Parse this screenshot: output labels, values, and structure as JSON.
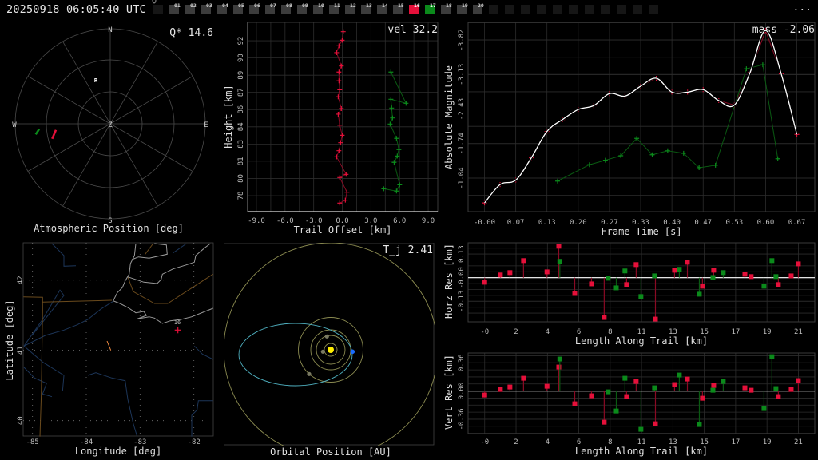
{
  "header": {
    "timestamp": "20250918 06:05:40 UTC",
    "menu_label": "...",
    "stations": [
      {
        "label": "01",
        "state": "idle"
      },
      {
        "label": "02",
        "state": "idle"
      },
      {
        "label": "03",
        "state": "idle"
      },
      {
        "label": "04",
        "state": "idle"
      },
      {
        "label": "05",
        "state": "idle"
      },
      {
        "label": "06",
        "state": "idle"
      },
      {
        "label": "07",
        "state": "idle"
      },
      {
        "label": "08",
        "state": "idle"
      },
      {
        "label": "09",
        "state": "idle"
      },
      {
        "label": "10",
        "state": "idle"
      },
      {
        "label": "11",
        "state": "idle"
      },
      {
        "label": "12",
        "state": "idle"
      },
      {
        "label": "13",
        "state": "idle"
      },
      {
        "label": "14",
        "state": "idle"
      },
      {
        "label": "15",
        "state": "idle"
      },
      {
        "label": "16",
        "state": "red"
      },
      {
        "label": "17",
        "state": "green"
      },
      {
        "label": "18",
        "state": "idle"
      },
      {
        "label": "19",
        "state": "idle"
      },
      {
        "label": "20",
        "state": "idle"
      }
    ]
  },
  "colors": {
    "station_a": "#e5103a",
    "station_b": "#0b8a1b",
    "fit": "#ffffff",
    "orbit": "#4fb0c0",
    "planet_orbit": "#8a8a50",
    "sun": "#ffee00",
    "earth": "#1a6cff"
  },
  "polar": {
    "title": "Atmospheric Position [deg]",
    "stat": "Q* 14.6",
    "labels": {
      "n": "N",
      "s": "S",
      "e": "E",
      "w": "W",
      "z": "Z",
      "radiant": "R"
    }
  },
  "map": {
    "xlabel": "Longitude [deg]",
    "ylabel": "Latitude [deg]",
    "lon_ticks": [
      "-85",
      "-84",
      "-83",
      "-82"
    ],
    "lat_ticks": [
      "40",
      "41",
      "42"
    ],
    "station_label": "16"
  },
  "orbit": {
    "title": "Orbital Position [AU]",
    "stat": "T_j 2.41"
  },
  "chart_data": [
    {
      "type": "line",
      "title": "",
      "stat": "vel 32.2",
      "xlabel": "Trail Offset [km]",
      "ylabel": "Height [km]",
      "xlim": [
        -9.92,
        10.0
      ],
      "ylim": [
        76.76,
        93.81
      ],
      "x_ticks": {
        "values": [
          -9,
          -6,
          -3,
          0,
          3,
          6,
          9
        ],
        "labels": [
          "-9.0",
          "-6.0",
          "-3.0",
          "0.0",
          "3.0",
          "6.0",
          "9.0"
        ]
      },
      "y_ticks": {
        "values": [
          78.2,
          79.75,
          81.3,
          82.85,
          84.4,
          85.95,
          87.5,
          89.05,
          90.6,
          92.15
        ],
        "labels": [
          "78",
          "80",
          "81",
          "83",
          "84",
          "86",
          "87",
          "89",
          "90",
          "92"
        ]
      },
      "series": [
        {
          "name": "station-16",
          "color": "#e5103a",
          "x": [
            0.1,
            -0.01,
            -0.35,
            -0.6,
            -0.1,
            -0.35,
            -0.35,
            -0.27,
            -0.43,
            -0.1,
            -0.43,
            -0.27,
            -0.01,
            -0.18,
            -0.35,
            -0.6,
            0.4,
            -0.27,
            0.49,
            0.32,
            -0.27
          ],
          "y": [
            92.97,
            92.2,
            91.7,
            91.08,
            89.88,
            89.33,
            88.54,
            87.74,
            87.1,
            86.04,
            85.54,
            84.55,
            83.64,
            82.97,
            82.25,
            81.7,
            80.12,
            79.83,
            78.51,
            77.79,
            77.53
          ]
        },
        {
          "name": "station-17",
          "color": "#0b8a1b",
          "x": [
            5.09,
            6.68,
            5.09,
            5.17,
            5.26,
            5.01,
            5.68,
            5.93,
            5.76,
            5.43,
            6.01,
            5.68,
            4.34
          ],
          "y": [
            89.33,
            86.52,
            86.88,
            86.09,
            85.2,
            84.65,
            83.36,
            82.35,
            81.77,
            81.2,
            79.18,
            78.61,
            78.82
          ]
        }
      ]
    },
    {
      "type": "line",
      "title": "",
      "stat": "mass -2.06",
      "xlabel": "Frame Time [s]",
      "ylabel": "Absolute Magnitude",
      "xlim": [
        -0.035,
        0.705
      ],
      "ylim": [
        -0.365,
        -4.175
      ],
      "x_ticks": {
        "values": [
          0,
          0.0667,
          0.1333,
          0.2,
          0.2667,
          0.3333,
          0.4,
          0.4667,
          0.5333,
          0.6,
          0.6667
        ],
        "labels": [
          "-0.00",
          "0.07",
          "0.13",
          "0.20",
          "0.27",
          "0.33",
          "0.40",
          "0.47",
          "0.53",
          "0.60",
          "0.67"
        ]
      },
      "y_ticks": {
        "values": [
          -3.82,
          -3.125,
          -2.43,
          -1.735,
          -1.04
        ],
        "labels": [
          "-3.82",
          "-3.13",
          "-2.43",
          "-1.74",
          "-1.04"
        ]
      },
      "series": [
        {
          "name": "station-16",
          "color": "#e5103a",
          "x": [
            0,
            0.0333,
            0.0667,
            0.1,
            0.1333,
            0.1667,
            0.2,
            0.2333,
            0.2667,
            0.3,
            0.3333,
            0.3667,
            0.4,
            0.4333,
            0.4667,
            0.5,
            0.5333,
            0.5667,
            0.6,
            0.6333,
            0.6667
          ],
          "y": [
            -0.54,
            -0.91,
            -1.0,
            -1.45,
            -1.98,
            -2.22,
            -2.42,
            -2.5,
            -2.74,
            -2.69,
            -2.89,
            -3.05,
            -2.77,
            -2.77,
            -2.82,
            -2.6,
            -2.51,
            -3.16,
            -4.01,
            -3.14,
            -1.92
          ]
        },
        {
          "name": "station-17",
          "color": "#0b8a1b",
          "x": [
            0.156,
            0.224,
            0.258,
            0.291,
            0.325,
            0.358,
            0.391,
            0.425,
            0.458,
            0.493,
            0.559,
            0.594,
            0.626
          ],
          "y": [
            -0.98,
            -1.31,
            -1.4,
            -1.49,
            -1.84,
            -1.51,
            -1.59,
            -1.54,
            -1.25,
            -1.3,
            -3.24,
            -3.32,
            -1.43
          ]
        },
        {
          "name": "fit",
          "color": "#ffffff",
          "smooth_of": "station-16"
        }
      ]
    },
    {
      "type": "scatter",
      "title": "",
      "xlabel": "Length Along Trail [km]",
      "ylabel": "Horz Res [km]",
      "xlim": [
        -1.11,
        22.1
      ],
      "ylim": [
        -0.243,
        0.192
      ],
      "x_ticks": {
        "values": [
          0,
          2.1,
          4.2,
          6.3,
          8.4,
          10.5,
          12.6,
          14.7,
          16.8,
          18.9,
          21.0
        ],
        "labels": [
          "-0",
          "2",
          "4",
          "6",
          "8",
          "11",
          "13",
          "15",
          "17",
          "19",
          "21"
        ]
      },
      "y_ticks": {
        "values": [
          0.13,
          0.0,
          -0.13
        ],
        "labels": [
          "0.13",
          "-0.00",
          "-0.13"
        ]
      },
      "series": [
        {
          "name": "station-16",
          "color": "#e5103a",
          "x": [
            0,
            1.05,
            1.69,
            2.6,
            4.17,
            4.96,
            6.03,
            7.15,
            8.0,
            9.5,
            10.14,
            11.43,
            12.71,
            13.57,
            14.58,
            15.33,
            17.42,
            17.84,
            19.66,
            20.52,
            21.0
          ],
          "y": [
            -0.025,
            0.015,
            0.028,
            0.094,
            0.032,
            0.173,
            -0.087,
            -0.034,
            -0.219,
            -0.038,
            0.072,
            -0.228,
            0.041,
            0.085,
            -0.047,
            0.041,
            0.019,
            0.006,
            -0.038,
            0.01,
            0.076
          ]
        },
        {
          "name": "station-17",
          "color": "#0b8a1b",
          "x": [
            5.03,
            8.27,
            8.81,
            9.39,
            10.46,
            11.37,
            13.03,
            14.37,
            15.28,
            15.97,
            18.7,
            19.23,
            19.5
          ],
          "y": [
            0.09,
            -0.003,
            -0.056,
            0.037,
            -0.104,
            0.01,
            0.046,
            -0.091,
            0.001,
            0.028,
            -0.047,
            0.094,
            0.006
          ]
        }
      ]
    },
    {
      "type": "scatter",
      "title": "",
      "xlabel": "Length Along Trail [km]",
      "ylabel": "Vert Res [km]",
      "xlim": [
        -1.11,
        22.1
      ],
      "ylim": [
        -0.544,
        0.485
      ],
      "x_ticks": {
        "values": [
          0,
          2.1,
          4.2,
          6.3,
          8.4,
          10.5,
          12.6,
          14.7,
          16.8,
          18.9,
          21.0
        ],
        "labels": [
          "-0",
          "2",
          "4",
          "6",
          "8",
          "11",
          "13",
          "15",
          "17",
          "19",
          "21"
        ]
      },
      "y_ticks": {
        "values": [
          0.36,
          0.0,
          -0.36
        ],
        "labels": [
          "0.36",
          "0.00",
          "-0.36"
        ]
      },
      "series": [
        {
          "name": "station-16",
          "color": "#e5103a",
          "x": [
            0,
            1.05,
            1.69,
            2.6,
            4.17,
            4.96,
            6.03,
            7.15,
            8.0,
            9.5,
            10.14,
            11.43,
            12.71,
            13.57,
            14.58,
            15.33,
            17.42,
            17.84,
            19.66,
            20.52,
            21.0
          ],
          "y": [
            -0.051,
            0.02,
            0.051,
            0.163,
            0.061,
            0.306,
            -0.163,
            -0.061,
            -0.398,
            -0.071,
            0.122,
            -0.418,
            0.082,
            0.153,
            -0.092,
            0.071,
            0.041,
            0.01,
            -0.071,
            0.02,
            0.133
          ]
        },
        {
          "name": "station-17",
          "color": "#0b8a1b",
          "x": [
            5.03,
            8.27,
            8.81,
            9.39,
            10.46,
            11.37,
            13.03,
            14.37,
            15.28,
            15.97,
            18.7,
            19.23,
            19.5
          ],
          "y": [
            0.408,
            -0.01,
            -0.255,
            0.163,
            -0.489,
            0.041,
            0.204,
            -0.428,
            0.01,
            0.122,
            -0.224,
            0.438,
            0.031
          ]
        }
      ]
    }
  ]
}
